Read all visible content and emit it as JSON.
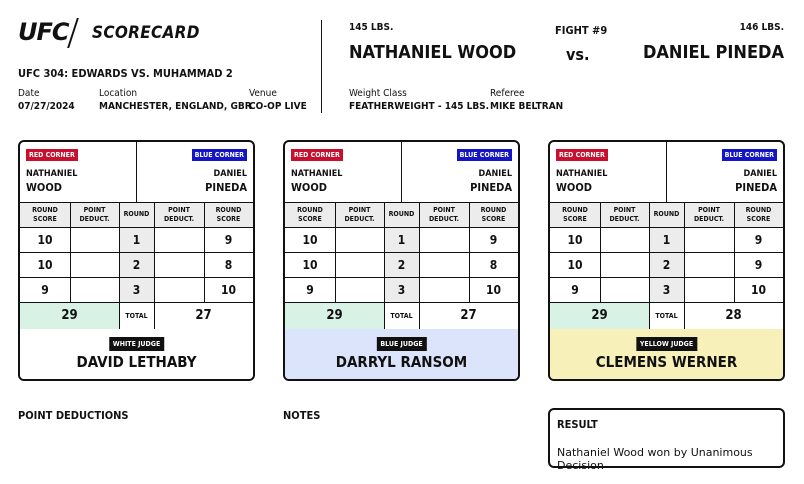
{
  "header": {
    "logo": "UFC",
    "title": "SCORECARD",
    "event": "UFC 304: EDWARDS VS. MUHAMMAD 2",
    "date_label": "Date",
    "date": "07/27/2024",
    "location_label": "Location",
    "location": "MANCHESTER, ENGLAND, GBR",
    "venue_label": "Venue",
    "venue": "CO-OP LIVE"
  },
  "fight": {
    "left_weight": "145 LBS.",
    "left_fighter": "NATHANIEL WOOD",
    "fight_number": "FIGHT #9",
    "vs": "vs.",
    "right_weight": "146 LBS.",
    "right_fighter": "DANIEL PINEDA",
    "weight_class_label": "Weight Class",
    "weight_class": "FEATHERWEIGHT - 145 LBS.",
    "referee_label": "Referee",
    "referee": "MIKE BELTRAN"
  },
  "labels": {
    "red_corner": "RED CORNER",
    "blue_corner": "BLUE CORNER",
    "red_first": "NATHANIEL",
    "red_last": "WOOD",
    "blue_first": "DANIEL",
    "blue_last": "PINEDA",
    "round_score": "ROUND SCORE",
    "point_deduct": "POINT DEDUCT.",
    "round": "ROUND",
    "total": "TOTAL"
  },
  "judges": [
    {
      "badge": "WHITE JUDGE",
      "name": "DAVID LETHABY",
      "color": "#ffffff",
      "rounds": [
        {
          "n": "1",
          "red": "10",
          "blue": "9"
        },
        {
          "n": "2",
          "red": "10",
          "blue": "8"
        },
        {
          "n": "3",
          "red": "9",
          "blue": "10"
        }
      ],
      "red_total": "29",
      "blue_total": "27"
    },
    {
      "badge": "BLUE JUDGE",
      "name": "DARRYL RANSOM",
      "color": "#dbe4fa",
      "rounds": [
        {
          "n": "1",
          "red": "10",
          "blue": "9"
        },
        {
          "n": "2",
          "red": "10",
          "blue": "8"
        },
        {
          "n": "3",
          "red": "9",
          "blue": "10"
        }
      ],
      "red_total": "29",
      "blue_total": "27"
    },
    {
      "badge": "YELLOW JUDGE",
      "name": "CLEMENS WERNER",
      "color": "#f7f0b9",
      "rounds": [
        {
          "n": "1",
          "red": "10",
          "blue": "9"
        },
        {
          "n": "2",
          "red": "10",
          "blue": "9"
        },
        {
          "n": "3",
          "red": "9",
          "blue": "10"
        }
      ],
      "red_total": "29",
      "blue_total": "28"
    }
  ],
  "colors": {
    "red_corner": "#c8102e",
    "blue_corner": "#1515c8",
    "winner_total": "#d9f2e6"
  },
  "footer": {
    "point_deductions": "POINT DEDUCTIONS",
    "notes": "NOTES",
    "result_title": "RESULT",
    "result_text": "Nathaniel Wood won by Unanimous Decision"
  }
}
